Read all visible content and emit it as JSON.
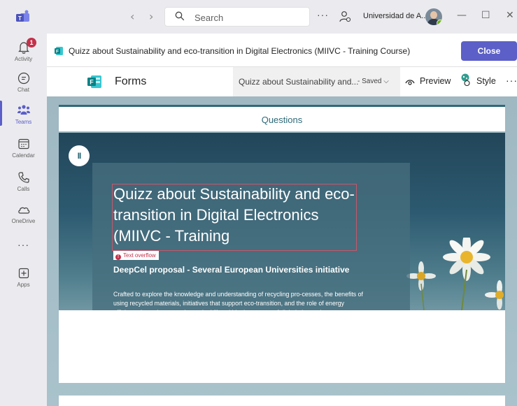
{
  "titlebar": {
    "search_placeholder": "Search",
    "more_label": "···",
    "org_name": "Universidad de A...",
    "back_arrow": "‹",
    "forward_arrow": "›",
    "minimize": "—",
    "maximize": "☐",
    "close": "✕"
  },
  "rail": {
    "items": [
      {
        "label": "Activity",
        "icon": "bell-icon",
        "badge": "1"
      },
      {
        "label": "Chat",
        "icon": "chat-icon"
      },
      {
        "label": "Teams",
        "icon": "teams-icon",
        "active": true
      },
      {
        "label": "Calendar",
        "icon": "calendar-icon"
      },
      {
        "label": "Calls",
        "icon": "phone-icon"
      },
      {
        "label": "OneDrive",
        "icon": "cloud-icon"
      },
      {
        "label": "···",
        "icon": "more-icon"
      },
      {
        "label": "Apps",
        "icon": "plus-square-icon"
      }
    ]
  },
  "apphead": {
    "title": "Quizz about Sustainability and eco-transition in Digital Electronics (MIIVC - Training Course)",
    "close_label": "Close"
  },
  "formsbar": {
    "app_name": "Forms",
    "doc_title": "Quizz about Sustainability and...",
    "saved_label": "- Saved ⌵",
    "preview_label": "Preview",
    "style_label": "Style",
    "more_label": "···"
  },
  "content": {
    "tab_label": "Questions",
    "pause_label": "II",
    "form_title": "Quizz about Sustainability and eco-transition in Digital Electronics (MIIVC - Training",
    "overflow_label": "Text overflow",
    "overflow_icon": "!",
    "subtitle": "DeepCel proposal - Several European Universities initiative",
    "description": "Crafted to explore the knowledge and understanding of recycling pro-cesses, the benefits of using recycled materials, initiatives that support eco-transition, and the role of energy efficiency in environmental sustainability within the context of digital electronic systems."
  },
  "colors": {
    "accent": "#5b5fc7",
    "teal": "#2f6a78",
    "error": "#c4314b"
  }
}
